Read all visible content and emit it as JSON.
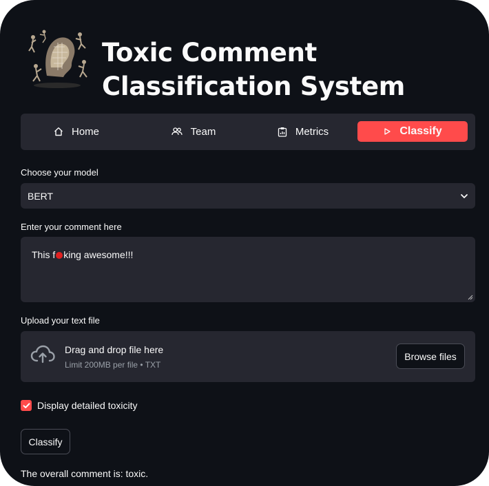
{
  "app": {
    "title": "Toxic Comment Classification System"
  },
  "nav": {
    "items": [
      {
        "label": "Home",
        "icon": "home-icon"
      },
      {
        "label": "Team",
        "icon": "team-icon"
      },
      {
        "label": "Metrics",
        "icon": "clipboard-icon"
      },
      {
        "label": "Classify",
        "icon": "play-icon",
        "active": true
      }
    ]
  },
  "model": {
    "label": "Choose your model",
    "selected": "BERT"
  },
  "comment": {
    "label": "Enter your comment here",
    "value_prefix": "This f",
    "value_suffix": "king awesome!!!"
  },
  "upload": {
    "label": "Upload your text file",
    "drop_text": "Drag and drop file here",
    "limit_text": "Limit 200MB per file • TXT",
    "browse_label": "Browse files"
  },
  "options": {
    "detailed_label": "Display detailed toxicity",
    "detailed_checked": true
  },
  "actions": {
    "classify_label": "Classify"
  },
  "result": {
    "text": "The overall comment is: toxic."
  },
  "colors": {
    "background": "#0e1117",
    "panel": "#262730",
    "accent": "#ff4b4b",
    "text": "#fafafa"
  }
}
